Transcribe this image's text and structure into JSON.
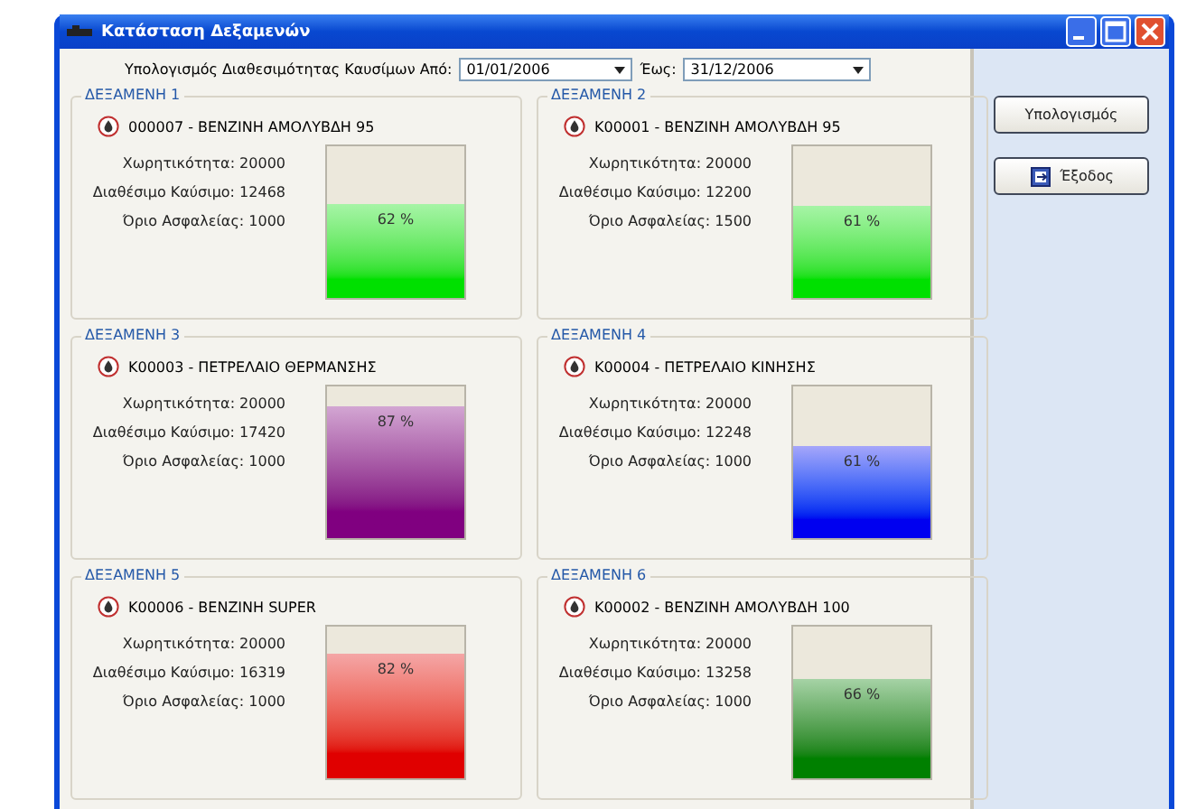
{
  "window": {
    "title": "Κατάσταση Δεξαμενών"
  },
  "filter": {
    "label": "Υπολογισμός Διαθεσιμότητας Καυσίμων Από:",
    "from": "01/01/2006",
    "to_label": "Έως:",
    "to": "31/12/2006"
  },
  "tanks": [
    {
      "title": "ΔΕΞΑΜΕΝΗ 1",
      "fuel": "000007 - ΒΕΝΖΙΝΗ ΑΜΟΛΥΒΔΗ 95",
      "capacity": "Χωρητικότητα: 20000",
      "available": "Διαθέσιμο Καύσιμο: 12468",
      "limit": "Όριο Ασφαλείας: 1000",
      "level": 0.62,
      "reading": "62 %",
      "color": "#00e000"
    },
    {
      "title": "ΔΕΞΑΜΕΝΗ 2",
      "fuel": "K00001 - ΒΕΝΖΙΝΗ ΑΜΟΛΥΒΔΗ 95",
      "capacity": "Χωρητικότητα: 20000",
      "available": "Διαθέσιμο Καύσιμο: 12200",
      "limit": "Όριο Ασφαλείας: 1500",
      "level": 0.61,
      "reading": "61 %",
      "color": "#00e000"
    },
    {
      "title": "ΔΕΞΑΜΕΝΗ 3",
      "fuel": "K00003 - ΠΕΤΡΕΛΑΙΟ ΘΕΡΜΑΝΣΗΣ",
      "capacity": "Χωρητικότητα: 20000",
      "available": "Διαθέσιμο Καύσιμο: 17420",
      "limit": "Όριο Ασφαλείας: 1000",
      "level": 0.87,
      "reading": "87 %",
      "color": "#800080"
    },
    {
      "title": "ΔΕΞΑΜΕΝΗ 4",
      "fuel": "K00004 - ΠΕΤΡΕΛΑΙΟ ΚΙΝΗΣΗΣ",
      "capacity": "Χωρητικότητα: 20000",
      "available": "Διαθέσιμο Καύσιμο: 12248",
      "limit": "Όριο Ασφαλείας: 1000",
      "level": 0.61,
      "reading": "61 %",
      "color": "#0000f0"
    },
    {
      "title": "ΔΕΞΑΜΕΝΗ 5",
      "fuel": "K00006 - ΒΕΝΖΙΝΗ SUPER",
      "capacity": "Χωρητικότητα: 20000",
      "available": "Διαθέσιμο Καύσιμο: 16319",
      "limit": "Όριο Ασφαλείας: 1000",
      "level": 0.82,
      "reading": "82 %",
      "color": "#e00000"
    },
    {
      "title": "ΔΕΞΑΜΕΝΗ 6",
      "fuel": "K00002 - ΒΕΝΖΙΝΗ ΑΜΟΛΥΒΔΗ 100",
      "capacity": "Χωρητικότητα: 20000",
      "available": "Διαθέσιμο Καύσιμο: 13258",
      "limit": "Όριο Ασφαλείας: 1000",
      "level": 0.66,
      "reading": "66 %",
      "color": "#008000"
    }
  ],
  "buttons": [
    {
      "label": "Υπολογισμός",
      "kind": "plain"
    },
    {
      "label": "Έξοδος",
      "kind": "exit"
    }
  ]
}
